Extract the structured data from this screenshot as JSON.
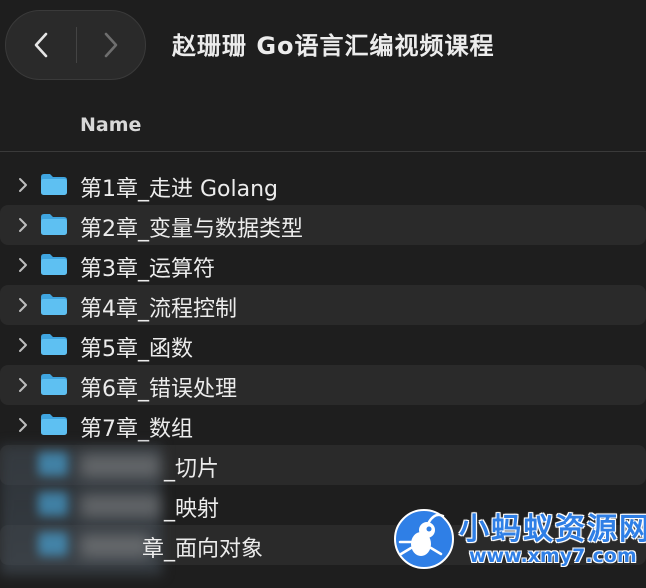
{
  "window": {
    "title": "赵珊珊 Go语言汇编视频课程"
  },
  "toolbar": {
    "back_icon": "chevron-left-icon",
    "forward_icon": "chevron-right-icon"
  },
  "columns": {
    "name": "Name"
  },
  "colors": {
    "folder": "#5ec0f2",
    "folder_tab": "#3fa5e0",
    "watermark": "#2f7fe6",
    "row_alt": "#2a2a2a"
  },
  "folders": [
    {
      "label": "第1章_走进 Golang",
      "icon": "folder-icon",
      "disclosure": "chevron-right-icon"
    },
    {
      "label": "第2章_变量与数据类型",
      "icon": "folder-icon",
      "disclosure": "chevron-right-icon"
    },
    {
      "label": "第3章_运算符",
      "icon": "folder-icon",
      "disclosure": "chevron-right-icon"
    },
    {
      "label": "第4章_流程控制",
      "icon": "folder-icon",
      "disclosure": "chevron-right-icon"
    },
    {
      "label": "第5章_函数",
      "icon": "folder-icon",
      "disclosure": "chevron-right-icon"
    },
    {
      "label": "第6章_错误处理",
      "icon": "folder-icon",
      "disclosure": "chevron-right-icon"
    },
    {
      "label": "第7章_数组",
      "icon": "folder-icon",
      "disclosure": "chevron-right-icon"
    }
  ],
  "blurred_folders": [
    {
      "visible_label": "_切片"
    },
    {
      "visible_label": "_映射"
    },
    {
      "visible_label": "章_面向对象"
    }
  ],
  "watermark": {
    "title": "小蚂蚁资源网",
    "url": "www.xmy7.com",
    "logo_icon": "ant-logo-icon"
  }
}
